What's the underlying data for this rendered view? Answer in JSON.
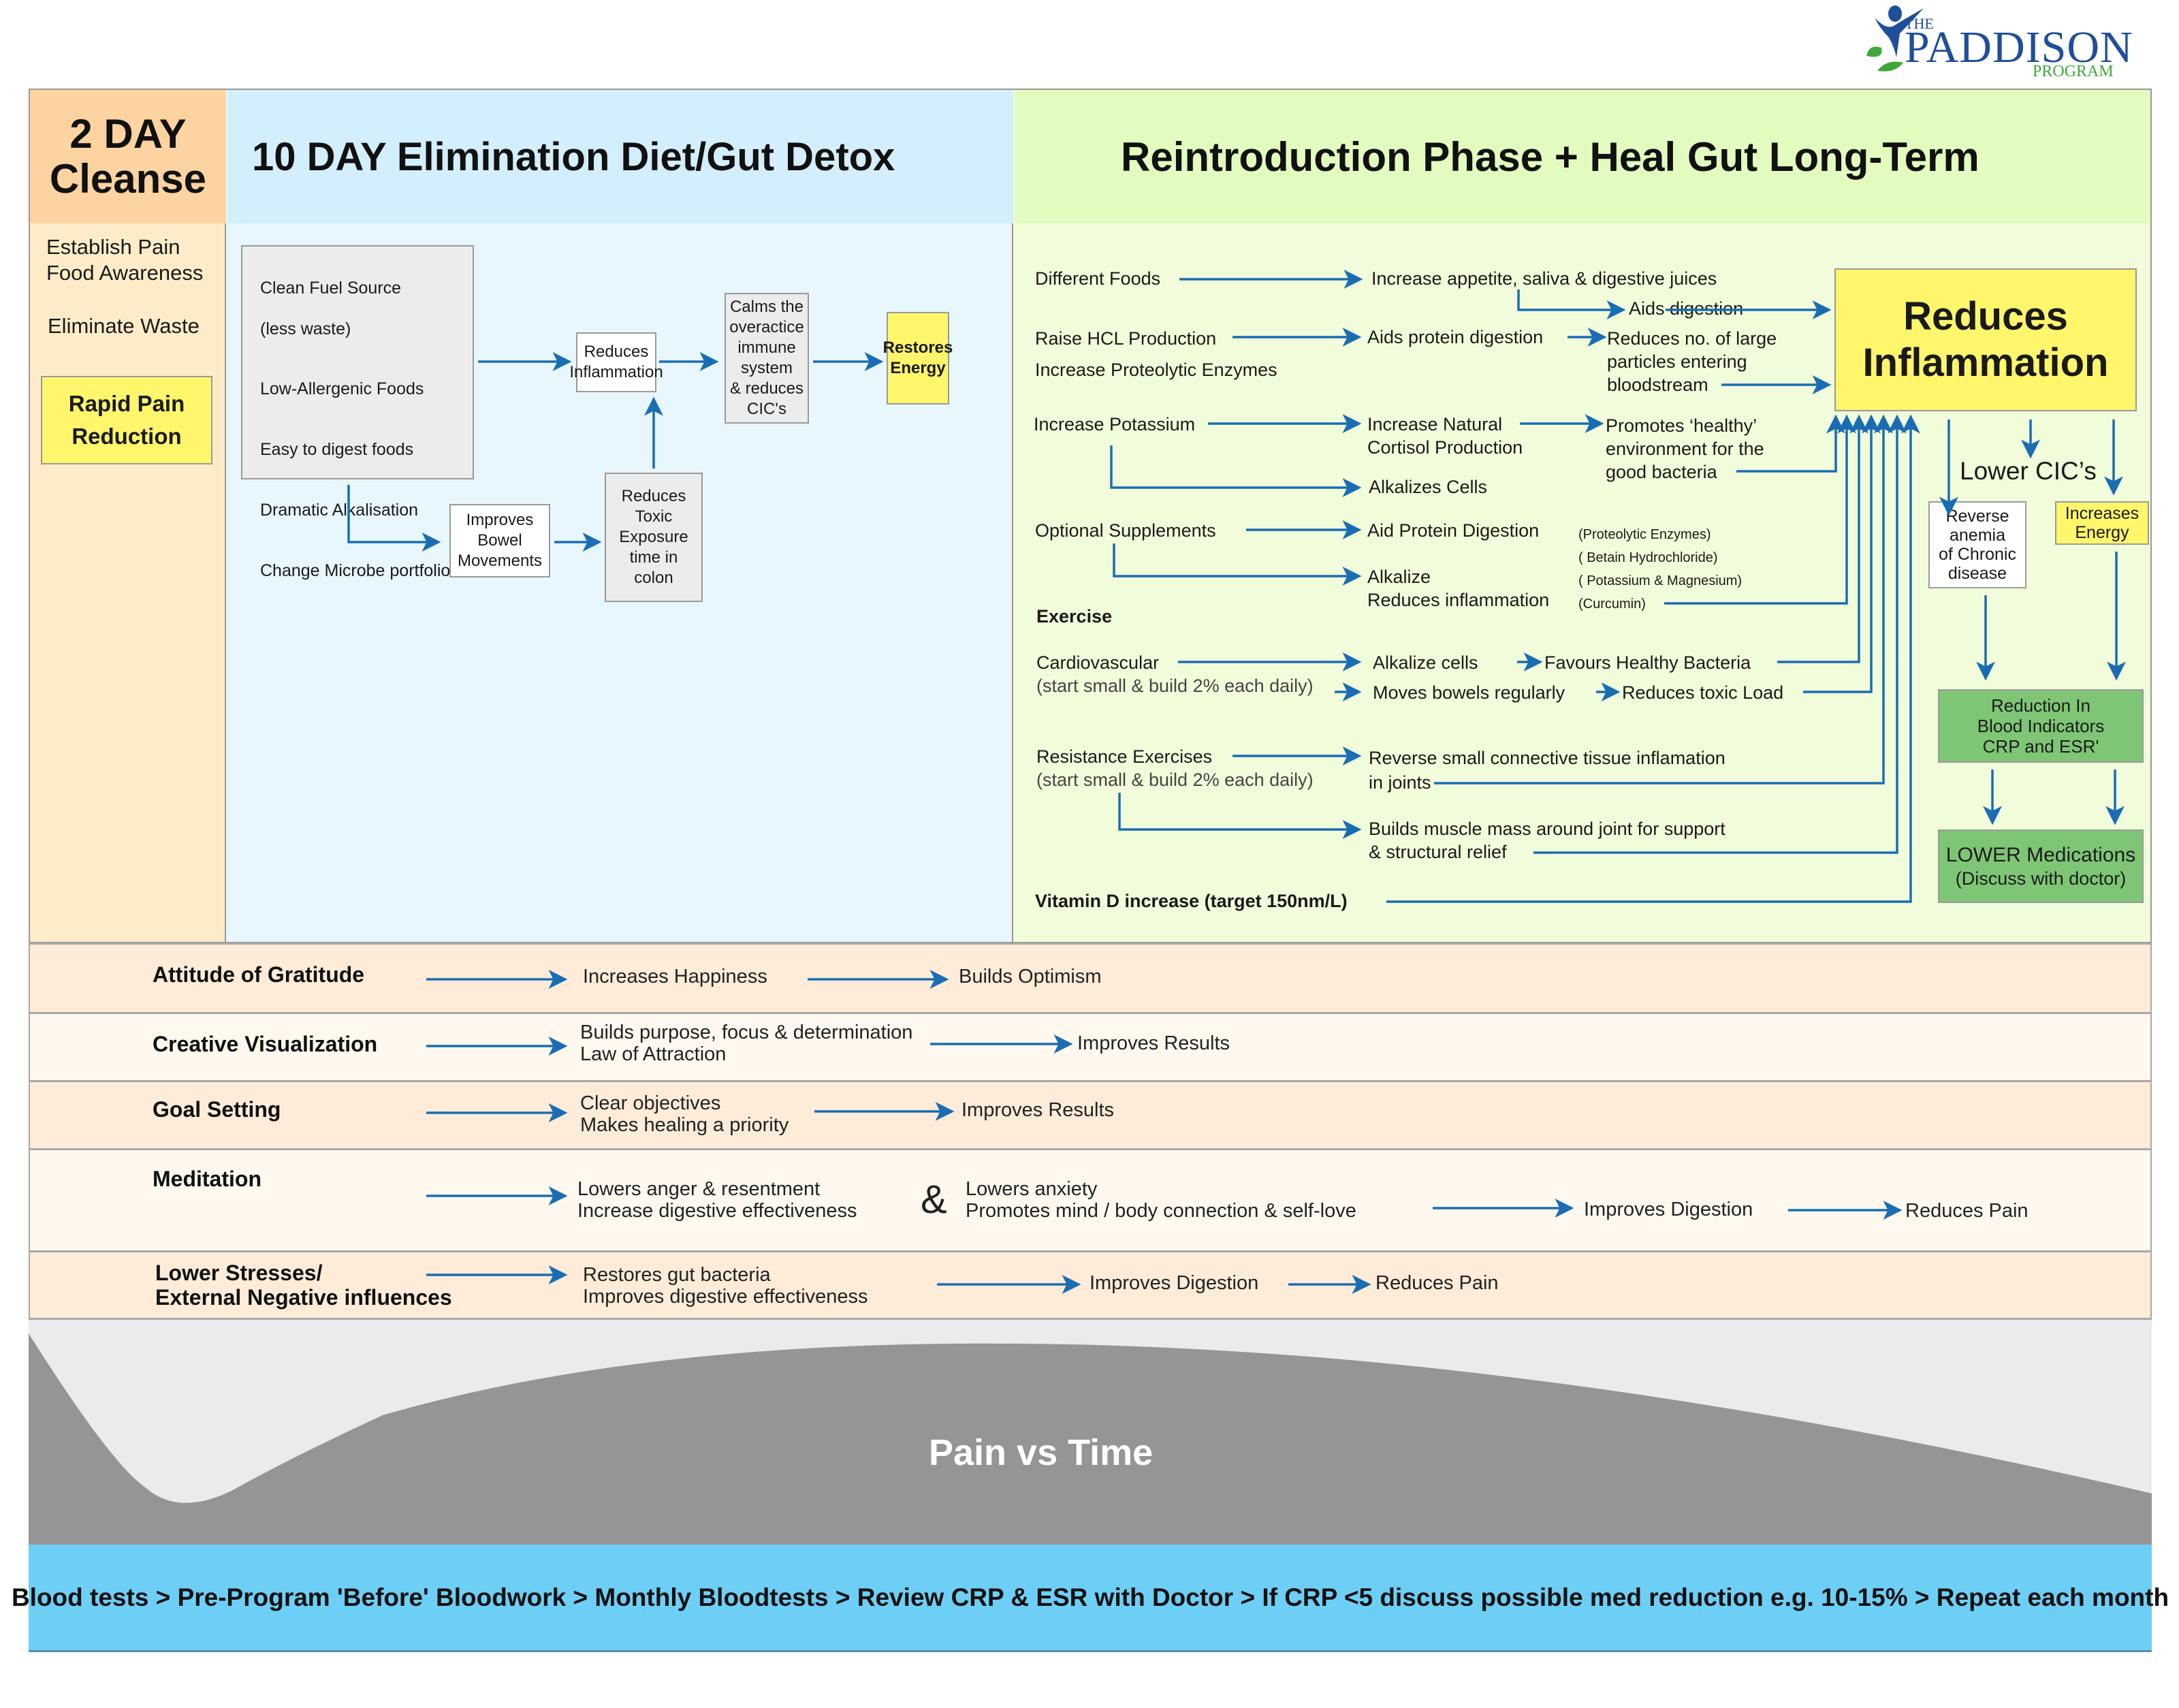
{
  "logo": {
    "the": "THE",
    "name": "PADDISON",
    "program": "PROGRAM"
  },
  "colors": {
    "arrow": "#1a6db3",
    "cleanse_header": "#fdd3a1",
    "cleanse_body": "#feecc8",
    "detox_header": "#d3eefd",
    "detox_body": "#e8f7fe",
    "reintro_header": "#e2fcc0",
    "reintro_body": "#f1fdda",
    "yellow": "#fff66b",
    "green": "#7ec675",
    "footer": "#6ecff6",
    "pain_curve": "#959595",
    "pain_bg": "#ebebeb"
  },
  "cleanse": {
    "title_line1": "2 DAY",
    "title_line2": "Cleanse",
    "item1_line1": "Establish Pain",
    "item1_line2": "Food Awareness",
    "item2": "Eliminate Waste",
    "highlight": "Rapid Pain\nReduction"
  },
  "detox": {
    "title": "10 DAY Elimination Diet/Gut Detox",
    "sources": [
      "Clean Fuel Source",
      "(less waste)",
      "Low-Allergenic Foods",
      "Easy to digest foods",
      "Dramatic Alkalisation",
      "Change Microbe portfolio"
    ],
    "reduces_inflammation": "Reduces\nInflammation",
    "calms": "Calms the\noveractice\nimmune system\n& reduces\nCIC's",
    "restores_energy": "Restores\nEnergy",
    "improves_bowel": "Improves\nBowel\nMovements",
    "reduces_toxic": "Reduces\nToxic\nExposure\ntime in\ncolon"
  },
  "reintro": {
    "title": "Reintroduction Phase + Heal Gut Long-Term",
    "different_foods": "Different Foods",
    "increase_appetite": "Increase appetite, saliva & digestive juices",
    "aids_digestion": "Aids digestion",
    "raise_hcl": "Raise HCL Production",
    "increase_enzymes": "Increase Proteolytic Enzymes",
    "aids_protein": "Aids protein digestion",
    "reduces_particles": [
      "Reduces no. of large",
      "particles entering",
      "bloodstream"
    ],
    "increase_potassium": "Increase Potassium",
    "increase_cortisol": [
      "Increase Natural",
      "Cortisol Production"
    ],
    "promotes_healthy": [
      "Promotes ‘healthy’",
      "environment for the",
      "good bacteria"
    ],
    "alkalizes_cells": "Alkalizes Cells",
    "optional_supplements": "Optional Supplements",
    "aid_protein_digestion": "Aid Protein Digestion",
    "alkalize": "Alkalize",
    "reduces_inflammation_small": "Reduces inflammation",
    "supp_notes": [
      "(Proteolytic Enzymes)",
      "( Betain Hydrochloride)",
      "( Potassium & Magnesium)",
      "(Curcumin)"
    ],
    "exercise": "Exercise",
    "cardio": "Cardiovascular",
    "cardio_note": "(start small & build 2% each daily)",
    "alkalize_cells": "Alkalize cells",
    "favours_bacteria": "Favours Healthy Bacteria",
    "moves_bowels": "Moves bowels regularly",
    "reduces_toxic_load": "Reduces toxic Load",
    "resistance": "Resistance Exercises",
    "resistance_note": "(start small & build 2% each daily)",
    "reverse_tissue": [
      "Reverse small connective tissue inflamation",
      "in joints"
    ],
    "builds_muscle": [
      "Builds muscle mass around joint for support",
      "& structural relief"
    ],
    "vitamin_d": "Vitamin D increase (target 150nm/L)",
    "reduces_inflammation_big": "Reduces\nInflammation",
    "lower_cics": "Lower CIC’s",
    "reverse_anemia": "Reverse\nanemia\nof Chronic\ndisease",
    "increases_energy": "Increases\nEnergy",
    "reduction_blood": "Reduction In\nBlood Indicators\nCRP and ESR'",
    "lower_meds_1": "LOWER Medications",
    "lower_meds_2": "(Discuss with doctor)"
  },
  "bands": [
    {
      "label": "Attitude of Gratitude",
      "steps": [
        "Increases Happiness",
        "Builds Optimism"
      ]
    },
    {
      "label": "Creative Visualization",
      "steps": [
        "Builds purpose, focus & determination",
        "Law of Attraction",
        "Improves Results"
      ]
    },
    {
      "label": "Goal Setting",
      "steps": [
        "Clear objectives",
        "Makes healing a priority",
        "Improves Results"
      ]
    },
    {
      "label": "Meditation",
      "steps": [
        "Lowers anger & resentment",
        "Increase digestive effectiveness",
        "&",
        "Lowers anxiety",
        "Promotes mind /  body connection & self-love",
        "Improves Digestion",
        "Reduces Pain"
      ]
    },
    {
      "label_line1": "Lower Stresses/",
      "label_line2": "External Negative influences",
      "steps": [
        "Restores gut bacteria",
        "Improves digestive effectiveness",
        "Improves Digestion",
        "Reduces Pain"
      ]
    }
  ],
  "pain_chart": {
    "title": "Pain vs Time"
  },
  "footer": {
    "text": "Blood tests > Pre-Program 'Before' Bloodwork > Monthly Bloodtests > Review CRP & ESR with Doctor > If CRP <5 discuss possible med reduction e.g. 10-15% > Repeat each month"
  }
}
